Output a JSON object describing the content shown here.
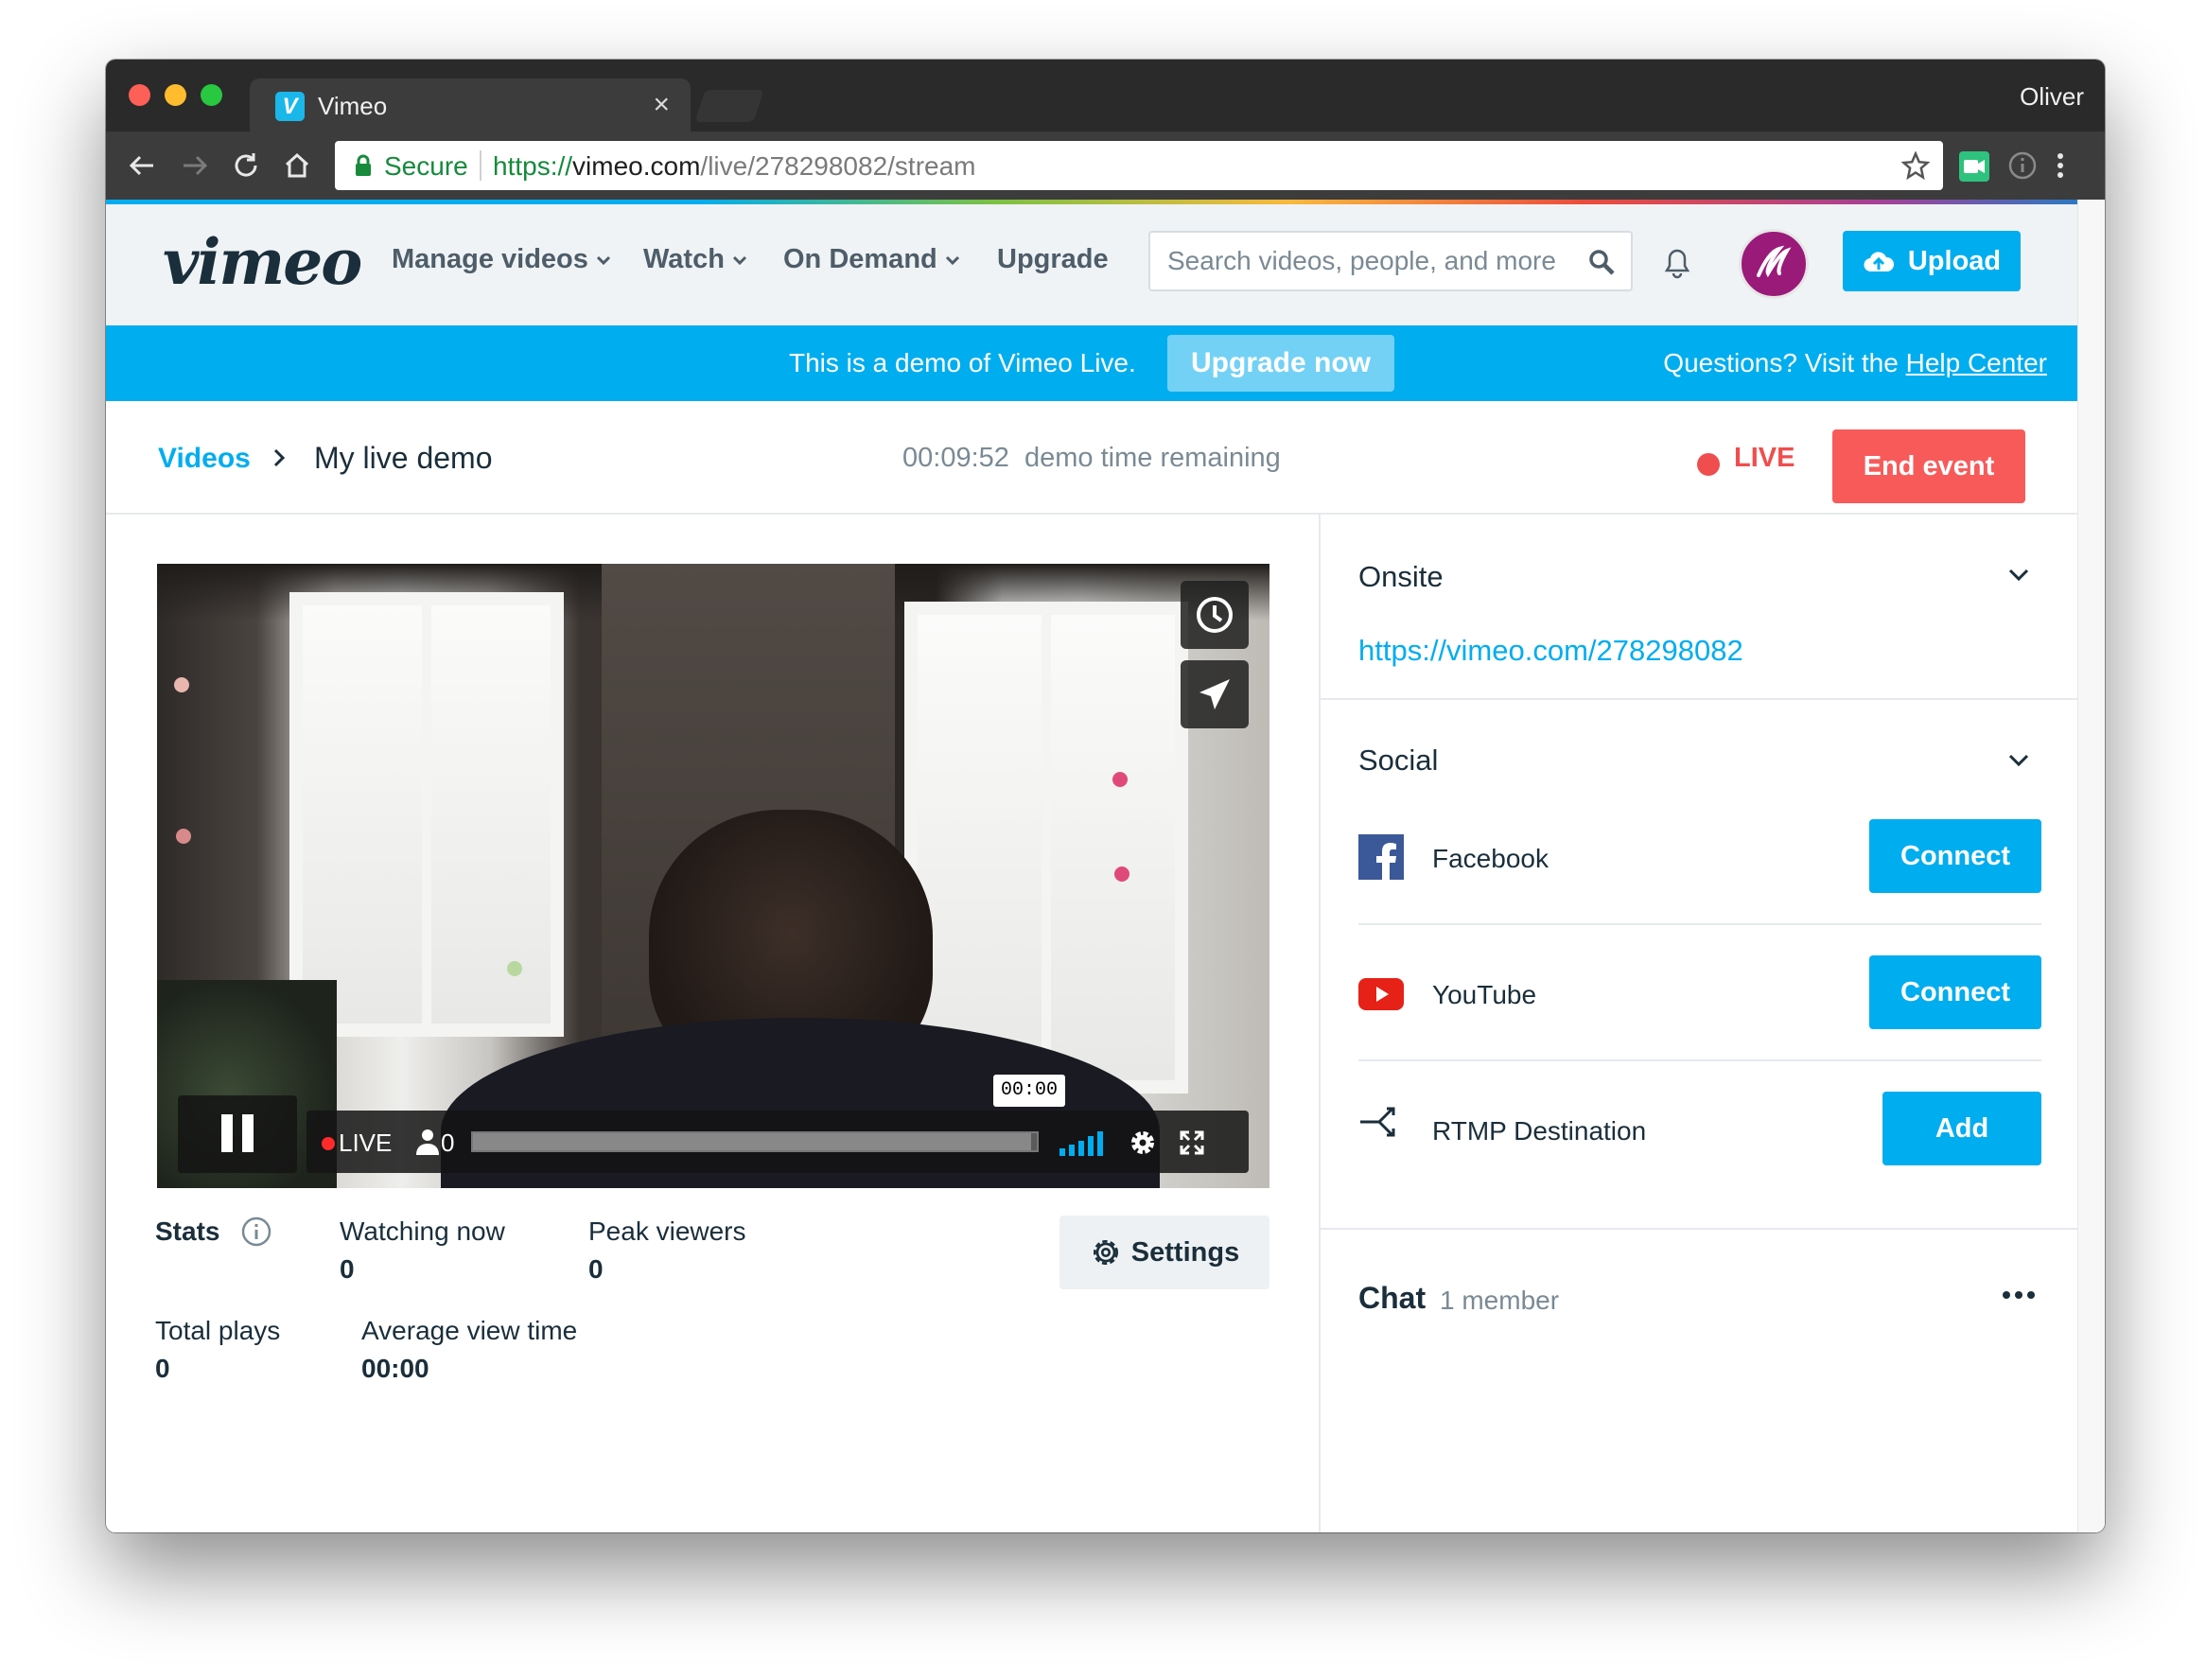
{
  "browser": {
    "tab_title": "Vimeo",
    "tab_favicon": "V",
    "tab_close": "×",
    "profile_name": "Oliver",
    "secure_label": "Secure",
    "url_scheme": "https://",
    "url_host": "vimeo.com",
    "url_path": "/live/278298082/stream"
  },
  "nav": {
    "logo": "vimeo",
    "items": [
      "Manage videos",
      "Watch",
      "On Demand",
      "Upgrade"
    ],
    "search_placeholder": "Search videos, people, and more",
    "upload_label": "Upload"
  },
  "banner": {
    "text": "This is a demo of Vimeo Live.",
    "upgrade_label": "Upgrade now",
    "help_prefix": "Questions? Visit the ",
    "help_link": "Help Center"
  },
  "header": {
    "breadcrumb_link": "Videos",
    "breadcrumb_current": "My live demo",
    "timer_value": "00:09:52",
    "timer_label": "demo time remaining",
    "live_label": "LIVE",
    "end_label": "End event"
  },
  "player": {
    "live_label": "LIVE",
    "viewer_count": "0",
    "time_tooltip": "00:00",
    "progress_fraction": 0.99
  },
  "stats": {
    "label": "Stats",
    "watching_now_label": "Watching now",
    "watching_now_value": "0",
    "peak_viewers_label": "Peak viewers",
    "peak_viewers_value": "0",
    "total_plays_label": "Total plays",
    "total_plays_value": "0",
    "avg_view_label": "Average view time",
    "avg_view_value": "00:00",
    "settings_label": "Settings"
  },
  "onsite": {
    "title": "Onsite",
    "link": "https://vimeo.com/278298082"
  },
  "social": {
    "title": "Social",
    "items": [
      {
        "name": "Facebook",
        "action": "Connect"
      },
      {
        "name": "YouTube",
        "action": "Connect"
      },
      {
        "name": "RTMP Destination",
        "action": "Add"
      }
    ]
  },
  "chat": {
    "title": "Chat",
    "members": "1 member"
  },
  "colors": {
    "accent": "#00adef",
    "live_red": "#f04e4e",
    "end_button": "#f85a5a",
    "text_dark": "#1a2e3b",
    "text_muted": "#7a8a95"
  }
}
